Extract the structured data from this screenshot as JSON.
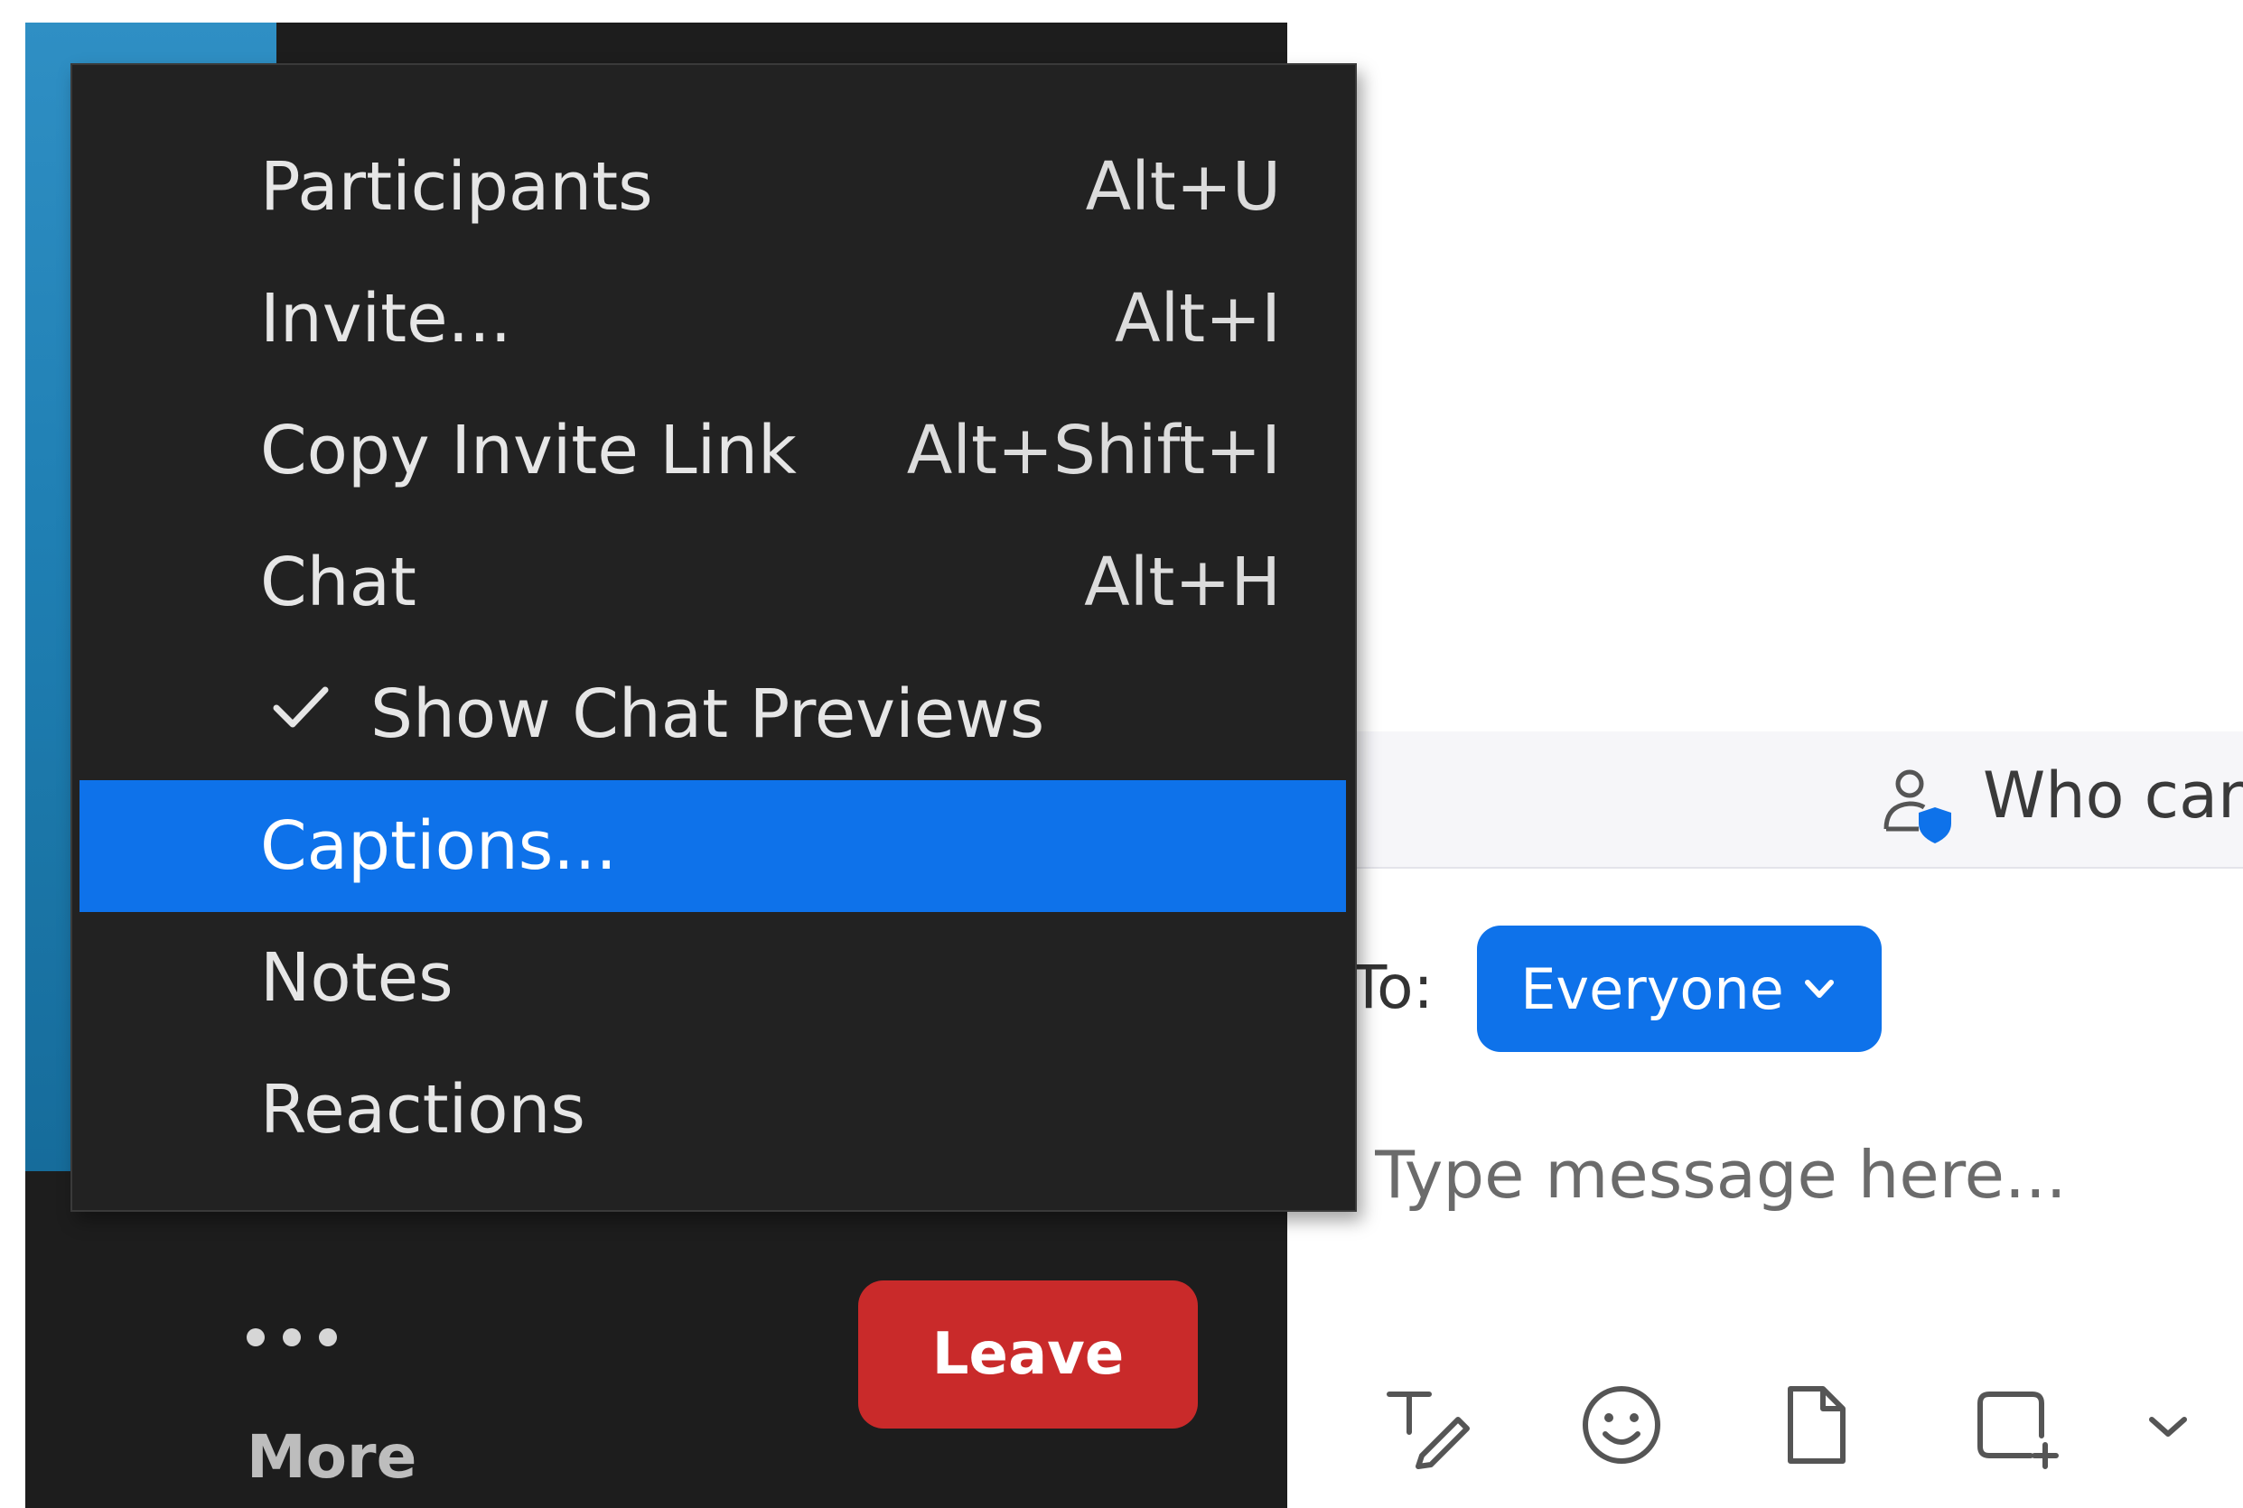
{
  "menu": {
    "items": [
      {
        "label": "Participants",
        "shortcut": "Alt+U"
      },
      {
        "label": "Invite...",
        "shortcut": "Alt+I"
      },
      {
        "label": "Copy Invite Link",
        "shortcut": "Alt+Shift+I"
      },
      {
        "label": "Chat",
        "shortcut": "Alt+H"
      },
      {
        "label": "Show Chat Previews",
        "checked": true
      },
      {
        "label": "Captions...",
        "highlighted": true
      },
      {
        "label": "Notes"
      },
      {
        "label": "Reactions"
      }
    ]
  },
  "toolbar": {
    "more_label": "More",
    "leave_label": "Leave"
  },
  "chat": {
    "privacy_text": "Who can",
    "to_label": "To:",
    "recipient": "Everyone",
    "message_placeholder": "Type message here...",
    "tools": [
      "format-text-icon",
      "emoji-icon",
      "file-icon",
      "screenshot-icon",
      "chevron-down-icon"
    ]
  },
  "colors": {
    "accent": "#0e72ea",
    "leave": "#c92a2a",
    "menu_bg": "#222222"
  }
}
